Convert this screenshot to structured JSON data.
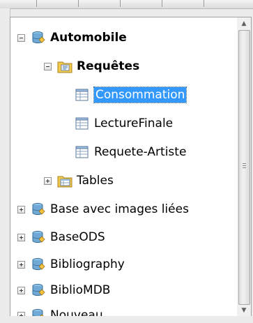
{
  "tree": {
    "items": [
      {
        "label": "Automobile",
        "type": "database",
        "expanded": true
      },
      {
        "label": "Requêtes",
        "type": "queries-folder",
        "expanded": true
      },
      {
        "label": "Consommation",
        "type": "query",
        "selected": true
      },
      {
        "label": "LectureFinale",
        "type": "query"
      },
      {
        "label": "Requete-Artiste",
        "type": "query"
      },
      {
        "label": "Tables",
        "type": "tables-folder",
        "expanded": false
      },
      {
        "label": "Base avec images liées",
        "type": "database",
        "expanded": false
      },
      {
        "label": "BaseODS",
        "type": "database",
        "expanded": false
      },
      {
        "label": "Bibliography",
        "type": "database",
        "expanded": false
      },
      {
        "label": "BiblioMDB",
        "type": "database",
        "expanded": false
      },
      {
        "label": "Nouveau",
        "type": "database",
        "expanded": false
      }
    ]
  },
  "icons": {
    "database": "database-icon",
    "queries-folder": "queries-folder-icon",
    "query": "query-icon",
    "tables-folder": "tables-folder-icon"
  },
  "colors": {
    "selection": "#3399ff",
    "selection_text": "#ffffff"
  }
}
